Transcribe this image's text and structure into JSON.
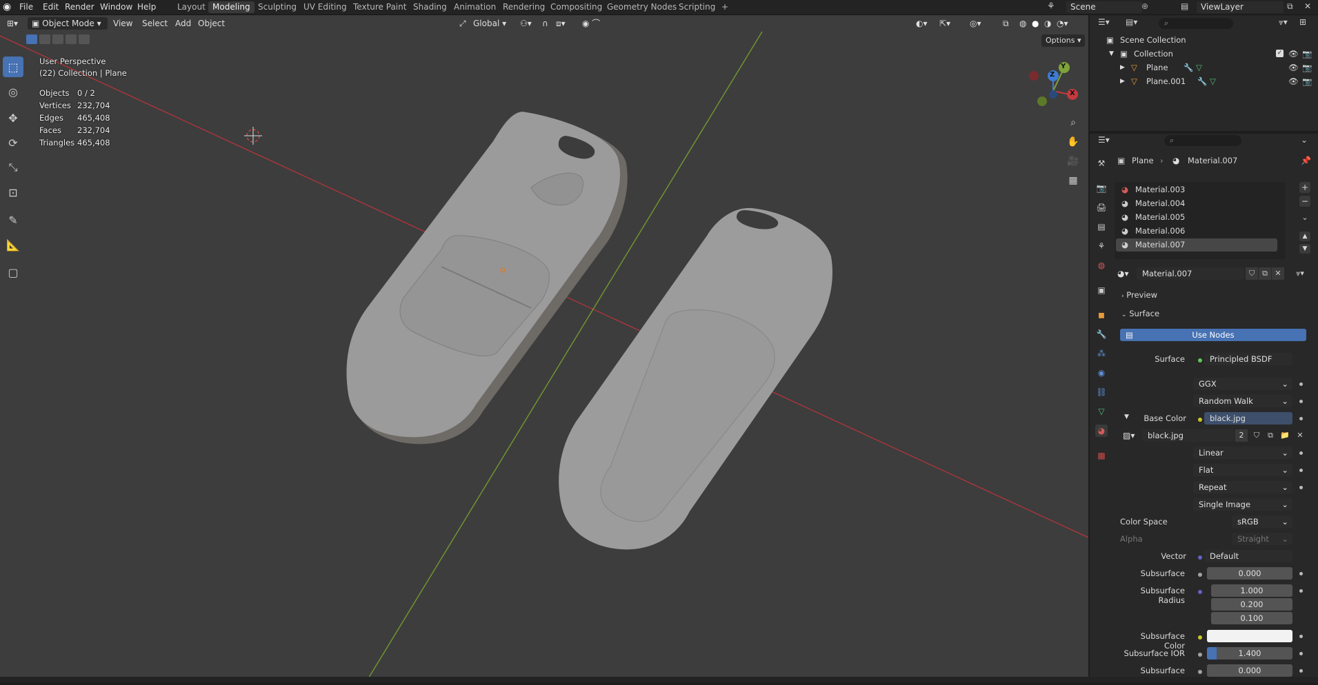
{
  "menu": [
    "File",
    "Edit",
    "Render",
    "Window",
    "Help"
  ],
  "workspaces": [
    "Layout",
    "Modeling",
    "Sculpting",
    "UV Editing",
    "Texture Paint",
    "Shading",
    "Animation",
    "Rendering",
    "Compositing",
    "Geometry Nodes",
    "Scripting",
    "+"
  ],
  "active_workspace": "Modeling",
  "scene_name": "Scene",
  "view_layer": "ViewLayer",
  "viewport": {
    "mode": "Object Mode",
    "menus": [
      "View",
      "Select",
      "Add",
      "Object"
    ],
    "transform_orientation": "Global",
    "options_label": "Options",
    "perspective": "User Perspective",
    "context": "(22) Collection | Plane",
    "stats": [
      {
        "label": "Objects",
        "value": "0 / 2"
      },
      {
        "label": "Vertices",
        "value": "232,704"
      },
      {
        "label": "Edges",
        "value": "465,408"
      },
      {
        "label": "Faces",
        "value": "232,704"
      },
      {
        "label": "Triangles",
        "value": "465,408"
      }
    ],
    "gizmo_axes": [
      "X",
      "Y",
      "Z"
    ]
  },
  "outliner": {
    "scene_collection": "Scene Collection",
    "collection": "Collection",
    "objects": [
      "Plane",
      "Plane.001"
    ]
  },
  "properties": {
    "breadcrumb_object": "Plane",
    "breadcrumb_material": "Material.007",
    "material_slots": [
      "Material.003",
      "Material.004",
      "Material.005",
      "Material.006",
      "Material.007"
    ],
    "active_material": "Material.007",
    "panels": {
      "preview": "Preview",
      "surface": "Surface"
    },
    "use_nodes": "Use Nodes",
    "surface_label": "Surface",
    "surface_shader": "Principled BSDF",
    "distribution": "GGX",
    "subsurface_method": "Random Walk",
    "base_color_label": "Base Color",
    "base_color_value": "black.jpg",
    "image_name": "black.jpg",
    "image_users": "2",
    "interpolation": "Linear",
    "projection": "Flat",
    "extension": "Repeat",
    "source": "Single Image",
    "color_space_label": "Color Space",
    "color_space": "sRGB",
    "alpha_label": "Alpha",
    "alpha": "Straight",
    "vector_label": "Vector",
    "vector": "Default",
    "subsurface_label": "Subsurface",
    "subsurface": "0.000",
    "subsurface_radius_label": "Subsurface Radius",
    "subsurface_radius": [
      "1.000",
      "0.200",
      "0.100"
    ],
    "subsurface_color_label": "Subsurface Color",
    "subsurface_ior_label": "Subsurface IOR",
    "subsurface_ior": "1.400",
    "subsurface_aniso_label": "Subsurface Aniso...",
    "subsurface_aniso": "0.000"
  },
  "colors": {
    "accent": "#4772b3",
    "x_axis": "#c4393f",
    "y_axis": "#7ea33a",
    "z_axis": "#3e7bd4"
  }
}
